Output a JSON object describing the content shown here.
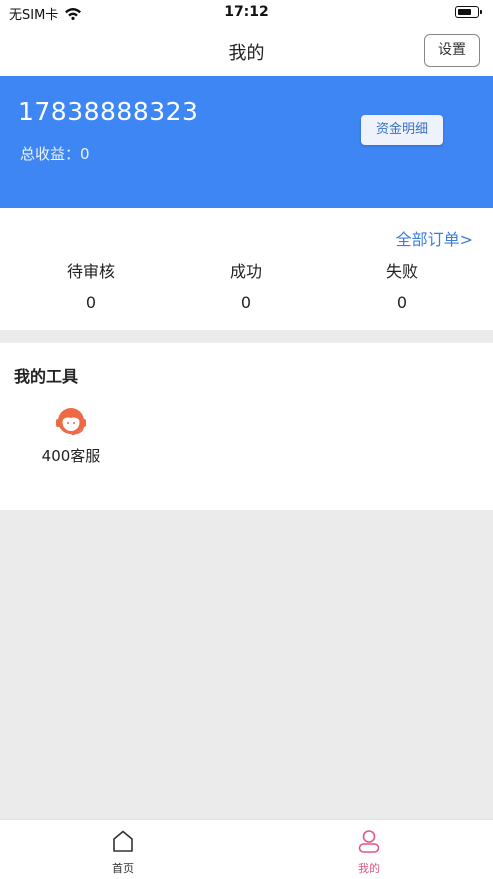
{
  "status_bar": {
    "carrier": "无SIM卡",
    "time": "17:12"
  },
  "nav": {
    "title": "我的",
    "settings_label": "设置"
  },
  "profile": {
    "phone": "17838888323",
    "earnings_label": "总收益：",
    "earnings_value": "0",
    "funds_button": "资金明细"
  },
  "orders": {
    "all_link": "全部订单>",
    "stats": [
      {
        "label": "待审核",
        "value": "0"
      },
      {
        "label": "成功",
        "value": "0"
      },
      {
        "label": "失败",
        "value": "0"
      }
    ]
  },
  "tools": {
    "title": "我的工具",
    "items": [
      {
        "label": "400客服",
        "icon": "customer-service-icon"
      }
    ]
  },
  "tab_bar": {
    "items": [
      {
        "label": "首页",
        "icon": "home-icon"
      },
      {
        "label": "我的",
        "icon": "user-icon"
      }
    ]
  },
  "colors": {
    "brand_blue": "#3f86f5",
    "link_blue": "#3f7fd9",
    "active_tab_pink": "#e0568a",
    "service_icon_orange": "#ee6a45"
  }
}
